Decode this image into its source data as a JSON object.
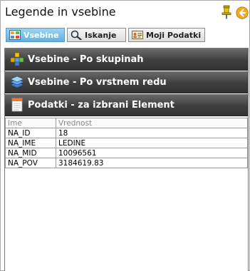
{
  "window": {
    "title": "Legende in vsebine"
  },
  "tabs": [
    {
      "label": "Vsebine",
      "icon": "grid-icon",
      "active": true
    },
    {
      "label": "Iskanje",
      "icon": "magnifier-icon",
      "active": false
    },
    {
      "label": "Moji Podatki",
      "icon": "id-card-icon",
      "active": false
    }
  ],
  "sections": [
    {
      "label": "Vsebine - Po skupinah",
      "icon": "shapes-icon"
    },
    {
      "label": "Vsebine - Po vrstnem redu",
      "icon": "layers-icon"
    },
    {
      "label": "Podatki - za izbrani Element",
      "icon": "document-icon"
    }
  ],
  "table": {
    "headers": [
      "Ime",
      "Vrednost"
    ],
    "rows": [
      [
        "NA_ID",
        "18"
      ],
      [
        "NA_IME",
        "LEDINE"
      ],
      [
        "NA_MID",
        "10096561"
      ],
      [
        "NA_POV",
        "3184619.83"
      ]
    ]
  },
  "colors": {
    "active_tab": "#5fb2e2",
    "section_bar": "#3f3f3f",
    "back_button": "#f5a623"
  }
}
